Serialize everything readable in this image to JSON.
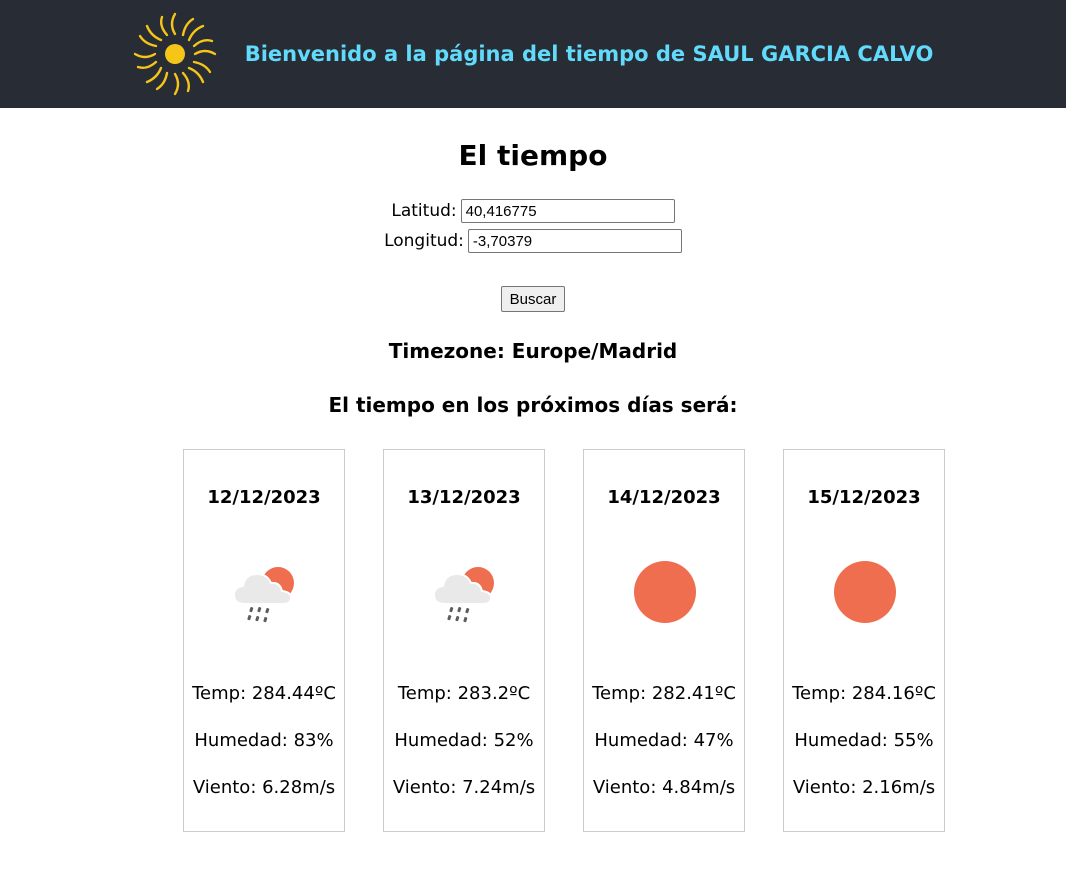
{
  "header": {
    "title": "Bienvenido a la página del tiempo de SAUL GARCIA CALVO",
    "logo_icon": "sun-icon",
    "logo_color": "#f5c518",
    "background": "#282c34",
    "title_color": "#61dafb"
  },
  "main": {
    "title": "El tiempo",
    "form": {
      "lat_label": "Latitud:",
      "lat_value": "40,416775",
      "lon_label": "Longitud:",
      "lon_value": "-3,70379",
      "button_label": "Buscar"
    },
    "timezone": "Timezone: Europe/Madrid",
    "forecast_title": "El tiempo en los próximos días será:",
    "days": [
      {
        "date": "12/12/2023",
        "icon": "rain-cloud-sun-icon",
        "temp": "Temp: 284.44ºC",
        "humidity": "Humedad: 83%",
        "wind": "Viento: 6.28m/s"
      },
      {
        "date": "13/12/2023",
        "icon": "rain-cloud-sun-icon",
        "temp": "Temp: 283.2ºC",
        "humidity": "Humedad: 52%",
        "wind": "Viento: 7.24m/s"
      },
      {
        "date": "14/12/2023",
        "icon": "sun-icon",
        "temp": "Temp: 282.41ºC",
        "humidity": "Humedad: 47%",
        "wind": "Viento: 4.84m/s"
      },
      {
        "date": "15/12/2023",
        "icon": "sun-icon",
        "temp": "Temp: 284.16ºC",
        "humidity": "Humedad: 55%",
        "wind": "Viento: 2.16m/s"
      }
    ],
    "sun_color": "#ee6e4f"
  }
}
